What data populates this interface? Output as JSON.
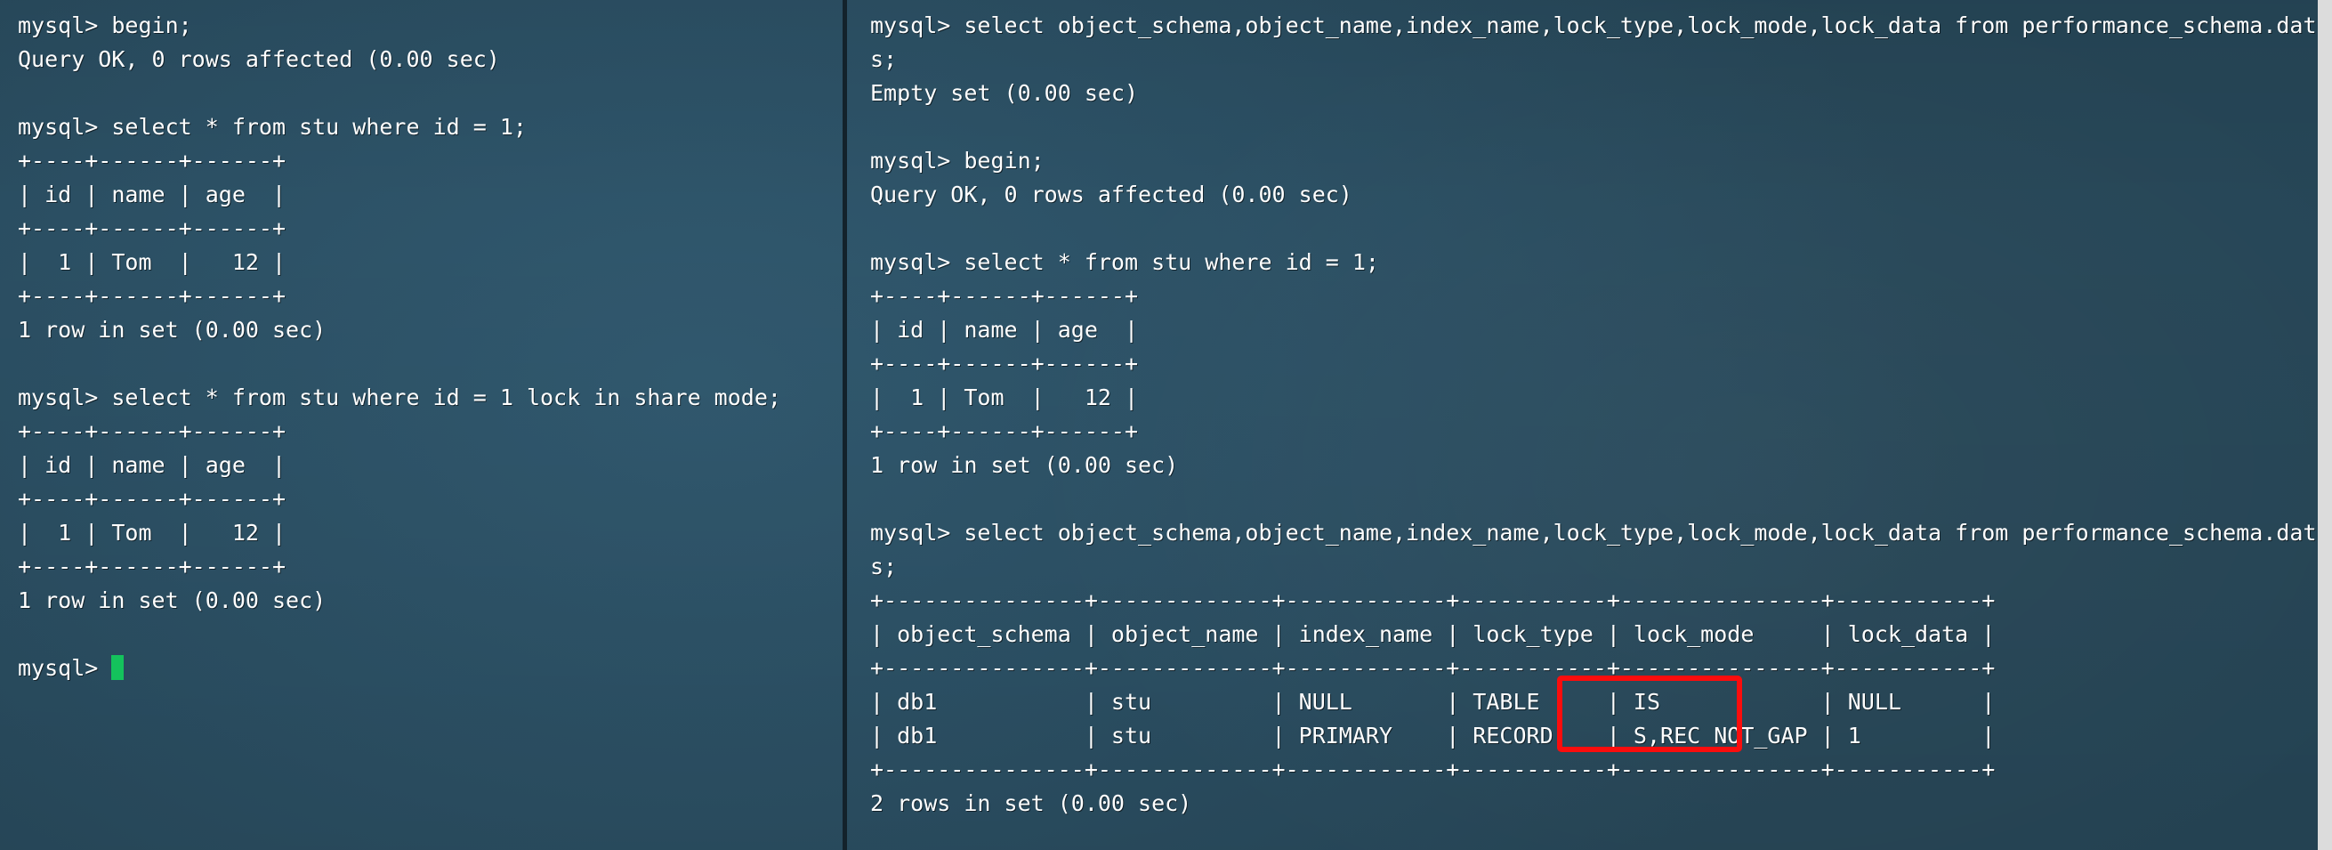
{
  "window": {
    "background_color": "#2b4f63",
    "text_color": "#ffffff",
    "divider_color": "#13222b",
    "cursor_color": "#14c25c",
    "highlight_color": "#fb0d0d",
    "scrollbar_color": "#dcdcdc"
  },
  "left_pane": {
    "name": "mysql-session-a",
    "prompt": "mysql>",
    "lines": [
      "mysql> begin;",
      "Query OK, 0 rows affected (0.00 sec)",
      "",
      "mysql> select * from stu where id = 1;",
      "+----+------+------+",
      "| id | name | age  |",
      "+----+------+------+",
      "|  1 | Tom  |   12 |",
      "+----+------+------+",
      "1 row in set (0.00 sec)",
      "",
      "mysql> select * from stu where id = 1 lock in share mode;",
      "+----+------+------+",
      "| id | name | age  |",
      "+----+------+------+",
      "|  1 | Tom  |   12 |",
      "+----+------+------+",
      "1 row in set (0.00 sec)",
      "",
      "mysql> "
    ]
  },
  "right_pane": {
    "name": "mysql-session-b",
    "prompt": "mysql>",
    "lines": [
      "mysql> select object_schema,object_name,index_name,lock_type,lock_mode,lock_data from performance_schema.data_lock",
      "s;",
      "Empty set (0.00 sec)",
      "",
      "mysql> begin;",
      "Query OK, 0 rows affected (0.00 sec)",
      "",
      "mysql> select * from stu where id = 1;",
      "+----+------+------+",
      "| id | name | age  |",
      "+----+------+------+",
      "|  1 | Tom  |   12 |",
      "+----+------+------+",
      "1 row in set (0.00 sec)",
      "",
      "mysql> select object_schema,object_name,index_name,lock_type,lock_mode,lock_data from performance_schema.data_lock",
      "s;",
      "+---------------+-------------+------------+-----------+---------------+-----------+",
      "| object_schema | object_name | index_name | lock_type | lock_mode     | lock_data |",
      "+---------------+-------------+------------+-----------+---------------+-----------+",
      "| db1           | stu         | NULL       | TABLE     | IS            | NULL      |",
      "| db1           | stu         | PRIMARY    | RECORD    | S,REC_NOT_GAP | 1         |",
      "+---------------+-------------+------------+-----------+---------------+-----------+",
      "2 rows in set (0.00 sec)"
    ]
  },
  "lock_result_table": {
    "columns": [
      "object_schema",
      "object_name",
      "index_name",
      "lock_type",
      "lock_mode",
      "lock_data"
    ],
    "rows": [
      [
        "db1",
        "stu",
        "NULL",
        "TABLE",
        "IS",
        "NULL"
      ],
      [
        "db1",
        "stu",
        "PRIMARY",
        "RECORD",
        "S,REC_NOT_GAP",
        "1"
      ]
    ],
    "row_count_text": "2 rows in set (0.00 sec)"
  },
  "stu_table": {
    "columns": [
      "id",
      "name",
      "age"
    ],
    "rows": [
      [
        "1",
        "Tom",
        "12"
      ]
    ],
    "row_count_text": "1 row in set (0.00 sec)"
  },
  "annotation": {
    "name": "lock-mode-highlight",
    "highlighted_values": [
      "IS",
      "S,REC_NOT_GAP"
    ]
  }
}
